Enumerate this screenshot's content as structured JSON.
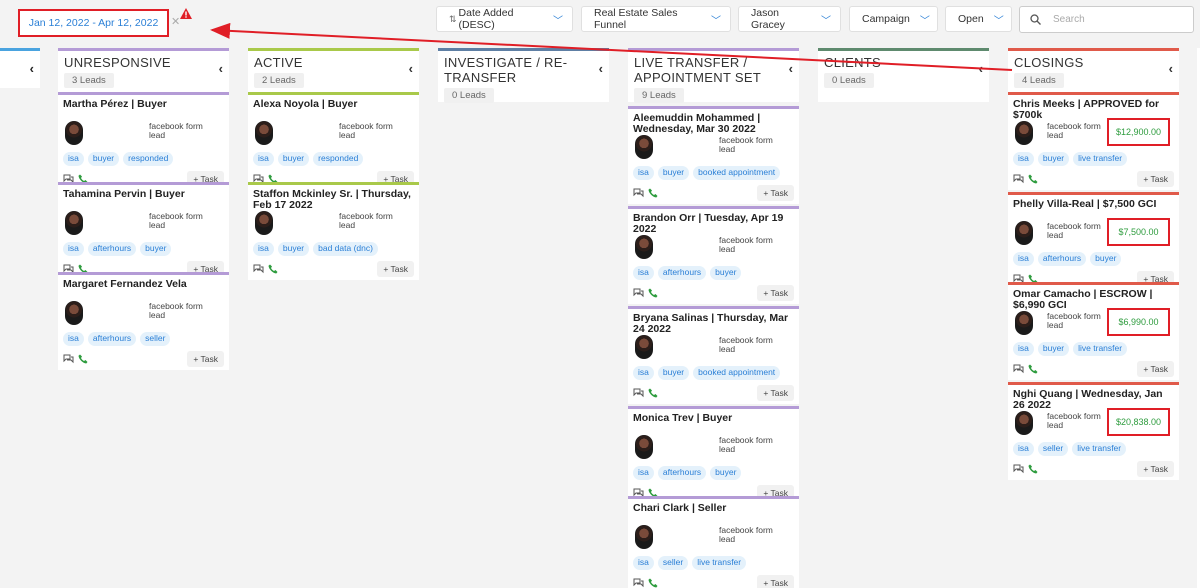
{
  "filters": {
    "date_range": "Jan 12, 2022 - Apr 12, 2022",
    "sort": "Date Added (DESC)",
    "funnel": "Real Estate Sales Funnel",
    "agent": "Jason Gracey",
    "campaign": "Campaign",
    "status": "Open",
    "search_placeholder": "Search"
  },
  "colors": {
    "border_highlight": "#e01e26",
    "link": "#2a7fd6",
    "amount": "#2e9c3e"
  },
  "columns": [
    {
      "title": "UNRESPONSIVE",
      "count": "3 Leads",
      "color": "#b49bd6"
    },
    {
      "title": "ACTIVE",
      "count": "2 Leads",
      "color": "#a9c94a"
    },
    {
      "title": "INVESTIGATE / RE-TRANSFER",
      "count": "0 Leads",
      "color": "#5e7fa4"
    },
    {
      "title": "LIVE TRANSFER / APPOINTMENT SET",
      "count": "9 Leads",
      "color": "#b49bd6"
    },
    {
      "title": "CLIENTS",
      "count": "0 Leads",
      "color": "#5e8a6e"
    },
    {
      "title": "CLOSINGS",
      "count": "4 Leads",
      "color": "#e05a4a"
    }
  ],
  "cards": {
    "unresponsive": [
      {
        "name": "Martha Pérez | Buyer",
        "source": "facebook form lead",
        "tags": [
          "isa",
          "buyer",
          "responded"
        ],
        "task": "+ Task"
      },
      {
        "name": "Tahamina Pervin | Buyer",
        "source": "facebook form lead",
        "tags": [
          "isa",
          "afterhours",
          "buyer"
        ],
        "task": "+ Task"
      },
      {
        "name": "Margaret Fernandez Vela",
        "source": "facebook form lead",
        "tags": [
          "isa",
          "afterhours",
          "seller"
        ],
        "task": "+ Task"
      }
    ],
    "active": [
      {
        "name": "Alexa Noyola | Buyer",
        "source": "facebook form lead",
        "tags": [
          "isa",
          "buyer",
          "responded"
        ],
        "task": "+ Task"
      },
      {
        "name": "Staffon Mckinley Sr. | Thursday, Feb 17 2022",
        "source": "facebook form lead",
        "tags": [
          "isa",
          "buyer",
          "bad data (dnc)"
        ],
        "task": "+ Task"
      }
    ],
    "live": [
      {
        "name": "Aleemuddin Mohammed | Wednesday, Mar 30 2022",
        "source": "facebook form lead",
        "tags": [
          "isa",
          "buyer",
          "booked appointment"
        ],
        "task": "+ Task"
      },
      {
        "name": "Brandon Orr | Tuesday, Apr 19 2022",
        "source": "facebook form lead",
        "tags": [
          "isa",
          "afterhours",
          "buyer"
        ],
        "task": "+ Task"
      },
      {
        "name": "Bryana Salinas | Thursday, Mar 24 2022",
        "source": "facebook form lead",
        "tags": [
          "isa",
          "buyer",
          "booked appointment"
        ],
        "task": "+ Task"
      },
      {
        "name": "Monica Trev | Buyer",
        "source": "facebook form lead",
        "tags": [
          "isa",
          "afterhours",
          "buyer"
        ],
        "task": "+ Task"
      },
      {
        "name": "Chari Clark | Seller",
        "source": "facebook form lead",
        "tags": [
          "isa",
          "seller",
          "live transfer"
        ],
        "task": "+ Task"
      }
    ],
    "closings": [
      {
        "name": "Chris Meeks | APPROVED for $700k",
        "source": "facebook form lead",
        "amount": "$12,900.00",
        "tags": [
          "isa",
          "buyer",
          "live transfer"
        ],
        "task": "+ Task"
      },
      {
        "name": "Phelly Villa-Real | $7,500 GCI",
        "source": "facebook form lead",
        "amount": "$7,500.00",
        "tags": [
          "isa",
          "afterhours",
          "buyer"
        ],
        "task": "+ Task"
      },
      {
        "name": "Omar Camacho | ESCROW | $6,990 GCI",
        "source": "facebook form lead",
        "amount": "$6,990.00",
        "tags": [
          "isa",
          "buyer",
          "live transfer"
        ],
        "task": "+ Task"
      },
      {
        "name": "Nghi Quang | Wednesday, Jan 26 2022",
        "source": "facebook form lead",
        "amount": "$20,838.00",
        "tags": [
          "isa",
          "seller",
          "live transfer"
        ],
        "task": "+ Task"
      }
    ]
  }
}
